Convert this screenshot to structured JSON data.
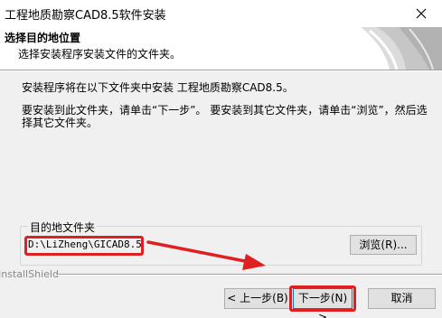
{
  "window": {
    "title": "工程地质勘察CAD8.5软件安装"
  },
  "header": {
    "title": "选择目的地位置",
    "subtitle": "选择安装程序安装文件的文件夹。"
  },
  "content": {
    "intro": "安装程序将在以下文件夹中安装 工程地质勘察CAD8.5。",
    "instructions": "要安装到此文件夹，请单击“下一步”。 要安装到其它文件夹，请单击“浏览”，然后选择其它文件夹。"
  },
  "destination": {
    "group_label": "目的地文件夹",
    "path": "D:\\LiZheng\\GICAD8.5",
    "browse_label": "浏览(R)..."
  },
  "footer": {
    "brand": "InstallShield",
    "back_label": "< 上一步(B)",
    "next_label": "下一步(N) >",
    "cancel_label": "取消"
  },
  "colors": {
    "annotation": "#e02020",
    "focus": "#0078d7",
    "background": "#f0f0f0"
  }
}
